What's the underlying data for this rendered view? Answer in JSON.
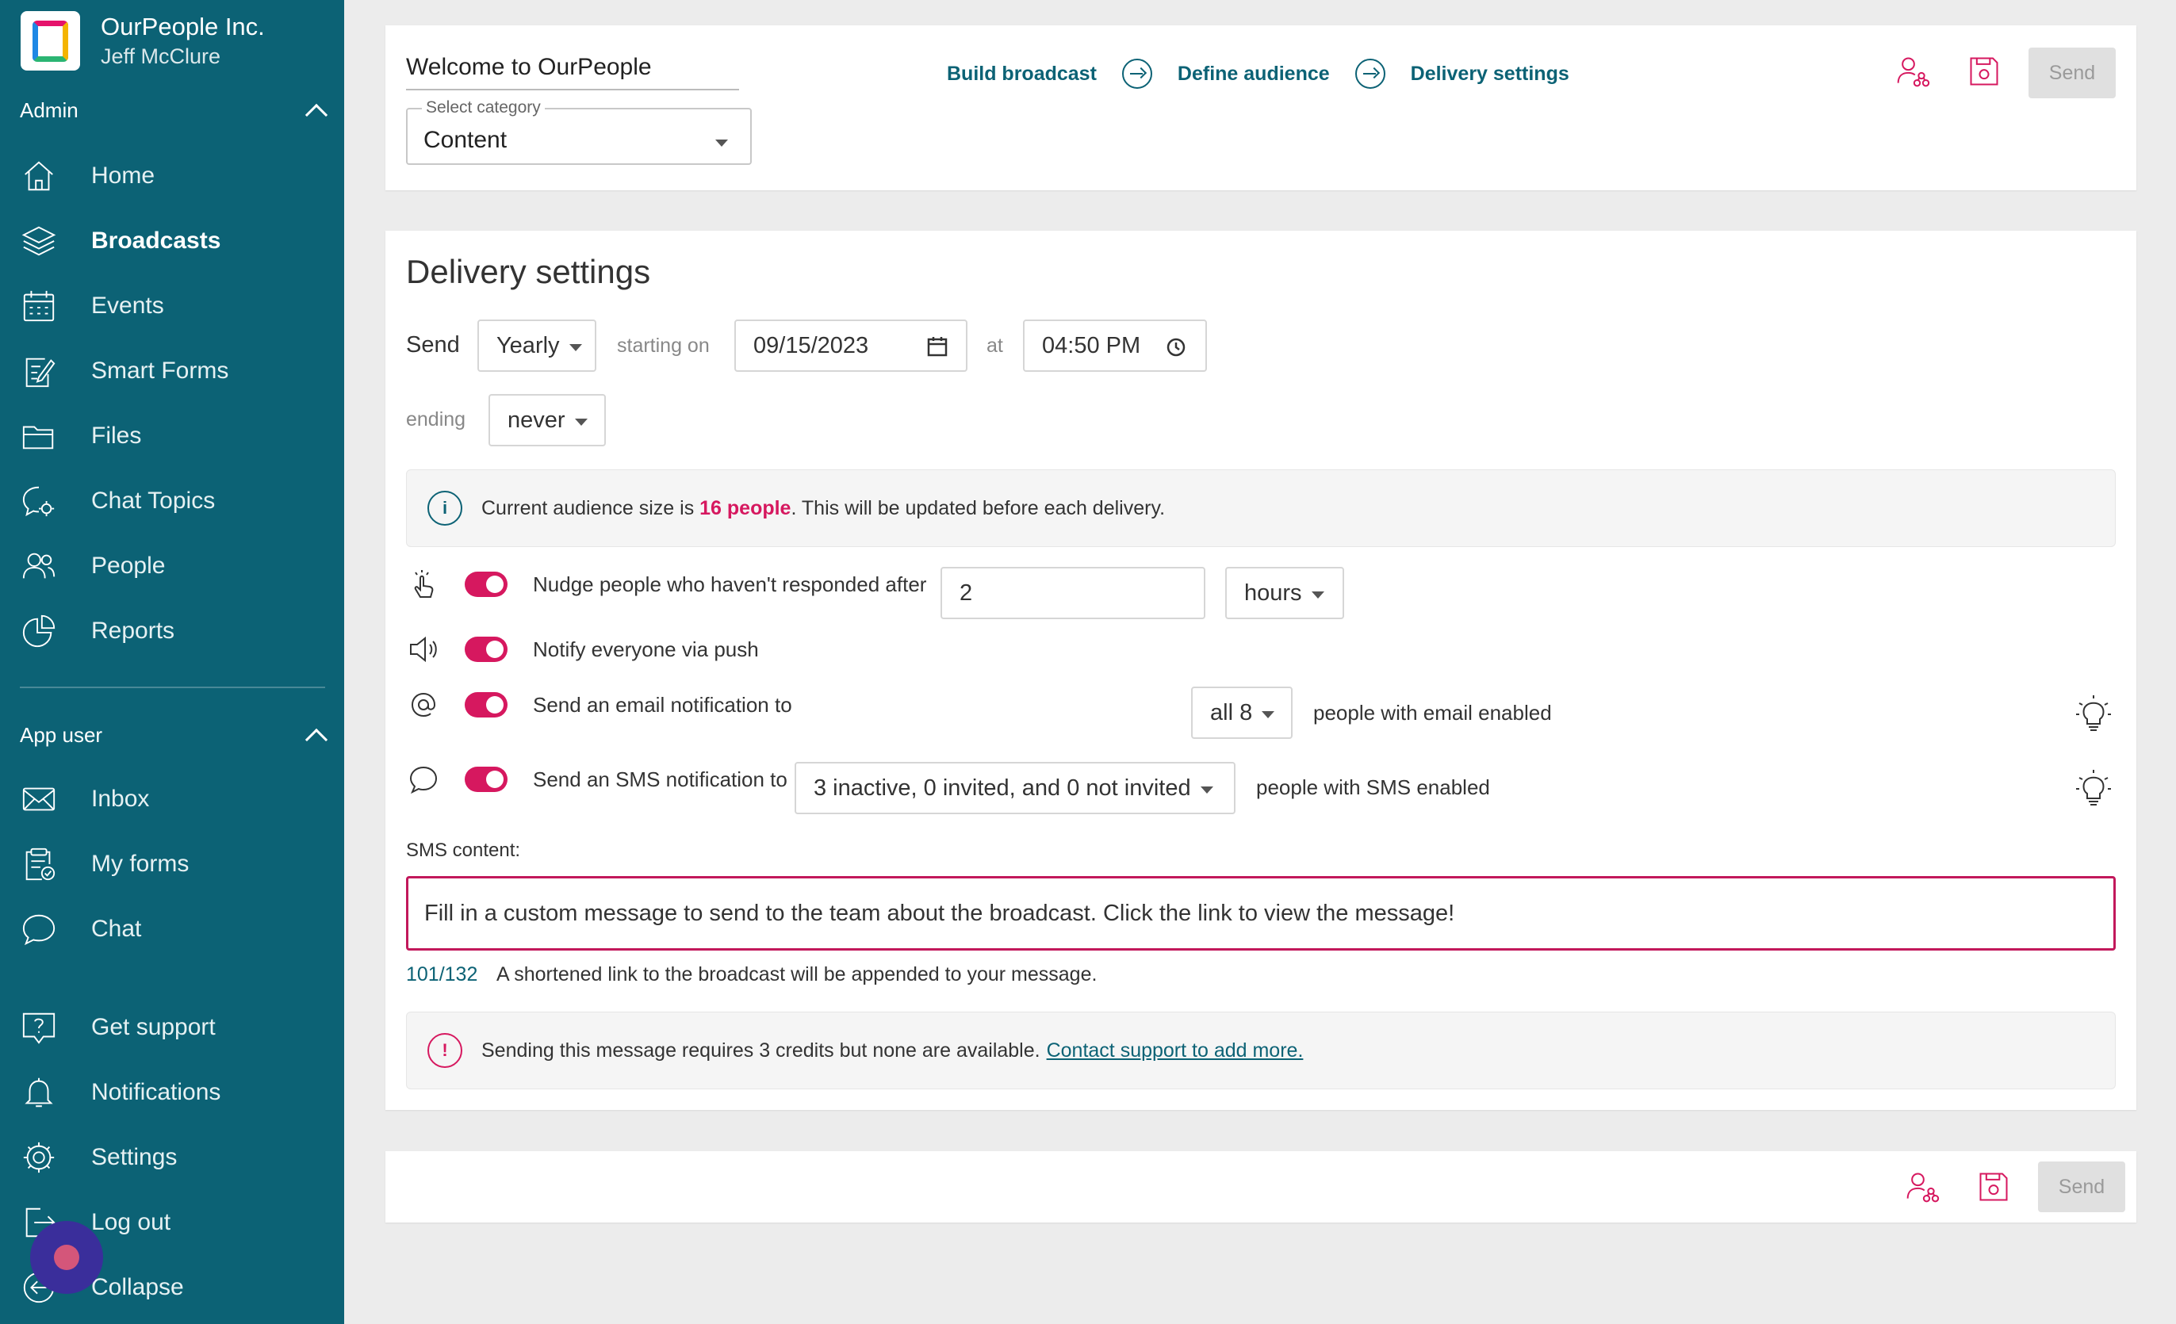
{
  "sidebar": {
    "org": "OurPeople Inc.",
    "user": "Jeff McClure",
    "admin_header": "Admin",
    "admin_items": [
      {
        "label": "Home",
        "icon": "home-icon"
      },
      {
        "label": "Broadcasts",
        "icon": "layers-icon"
      },
      {
        "label": "Events",
        "icon": "calendar-icon"
      },
      {
        "label": "Smart Forms",
        "icon": "form-edit-icon"
      },
      {
        "label": "Files",
        "icon": "folder-icon"
      },
      {
        "label": "Chat Topics",
        "icon": "chat-topics-icon"
      },
      {
        "label": "People",
        "icon": "people-icon"
      },
      {
        "label": "Reports",
        "icon": "pie-chart-icon"
      }
    ],
    "app_user_header": "App user",
    "app_user_items": [
      {
        "label": "Inbox",
        "icon": "envelope-icon"
      },
      {
        "label": "My forms",
        "icon": "clipboard-icon"
      },
      {
        "label": "Chat",
        "icon": "chat-bubble-icon"
      }
    ],
    "footer_items": [
      {
        "label": "Get support",
        "icon": "help-icon"
      },
      {
        "label": "Notifications",
        "icon": "bell-icon"
      },
      {
        "label": "Settings",
        "icon": "gear-icon"
      },
      {
        "label": "Log out",
        "icon": "logout-icon"
      },
      {
        "label": "Collapse",
        "icon": "collapse-icon"
      }
    ]
  },
  "header": {
    "broadcast_title": "Welcome to OurPeople",
    "category_label": "Select category",
    "category_value": "Content",
    "steps": [
      "Build broadcast",
      "Define audience",
      "Delivery settings"
    ],
    "send_label": "Send"
  },
  "delivery": {
    "title": "Delivery settings",
    "send_label": "Send",
    "frequency": "Yearly",
    "starting_on_label": "starting on",
    "date": "09/15/2023",
    "at_label": "at",
    "time": "04:50 PM",
    "ending_label": "ending",
    "ending_value": "never",
    "audience_prefix": "Current audience size is ",
    "audience_count": "16 people",
    "audience_suffix": ". This will be updated before each delivery.",
    "nudge_label": "Nudge people who haven't responded after",
    "nudge_value": "2",
    "nudge_unit": "hours",
    "push_label": "Notify everyone via push",
    "email_label": "Send an email notification to",
    "email_target": "all 8",
    "email_suffix": "people with email enabled",
    "sms_label": "Send an SMS notification to",
    "sms_target": "3 inactive, 0 invited, and 0 not invited",
    "sms_suffix": "people with SMS enabled",
    "sms_content_label": "SMS content:",
    "sms_content": "Fill in a custom message to send to the team about the broadcast. Click the link to view the message!",
    "char_count": "101/132",
    "char_note": "A shortened link to the broadcast will be appended to your message.",
    "credits_warning": "Sending this message requires 3 credits but none are available.",
    "contact_link": "Contact support to add more."
  },
  "footer": {
    "send_label": "Send"
  },
  "colors": {
    "sidebar": "#0c6275",
    "accent": "#d6185f",
    "link": "#0c6275"
  }
}
